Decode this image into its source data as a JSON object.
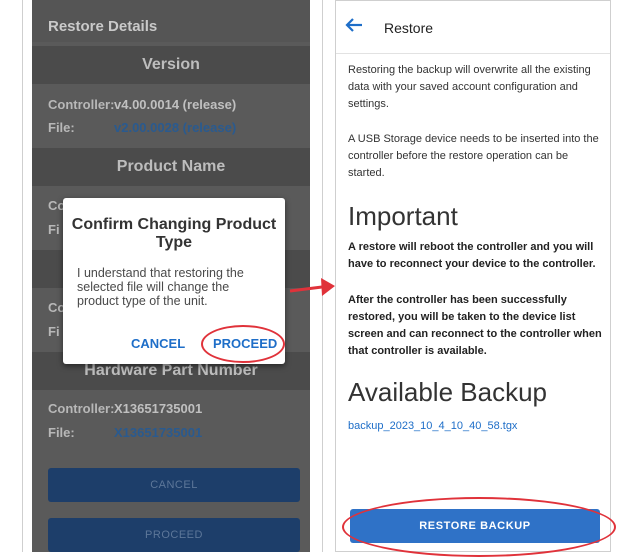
{
  "left": {
    "header": "Restore Details",
    "version_section": "Version",
    "version_rows": [
      {
        "key": "Controller:",
        "value": "v4.00.0014 (release)"
      },
      {
        "key": "File:",
        "value": "v2.00.0028 (release)"
      }
    ],
    "product_section": "Product Name",
    "hardware_section": "Hardware Part Number",
    "hardware_rows": [
      {
        "key": "Controller:",
        "value": "X13651735001"
      },
      {
        "key": "File:",
        "value": "X13651735001"
      }
    ],
    "partial_labels": [
      "Co",
      "Fi",
      "Co",
      "Fi"
    ],
    "cancel_label": "CANCEL",
    "proceed_label": "PROCEED"
  },
  "dialog": {
    "title": "Confirm Changing Product Type",
    "message": "I understand that restoring the selected file will change the product type of the unit.",
    "cancel": "CANCEL",
    "proceed": "PROCEED"
  },
  "right": {
    "title": "Restore",
    "para1": "Restoring the backup will overwrite all the existing data with your saved account configuration and settings.",
    "para2": "A USB Storage device needs to be inserted into the controller before the restore operation can be started.",
    "important_heading": "Important",
    "important_text1": "A restore will reboot the controller and you will have to reconnect your device to the controller.",
    "important_text2": "After the controller has been successfully restored, you will be taken to the device list screen and can reconnect to the controller when that controller is available.",
    "backup_heading": "Available Backup",
    "backup_file": "backup_2023_10_4_10_40_58.tgx",
    "restore_button": "RESTORE BACKUP"
  },
  "colors": {
    "accent": "#2f72c7",
    "annotation": "#e0323a",
    "overlay": "#5a5a5a"
  }
}
